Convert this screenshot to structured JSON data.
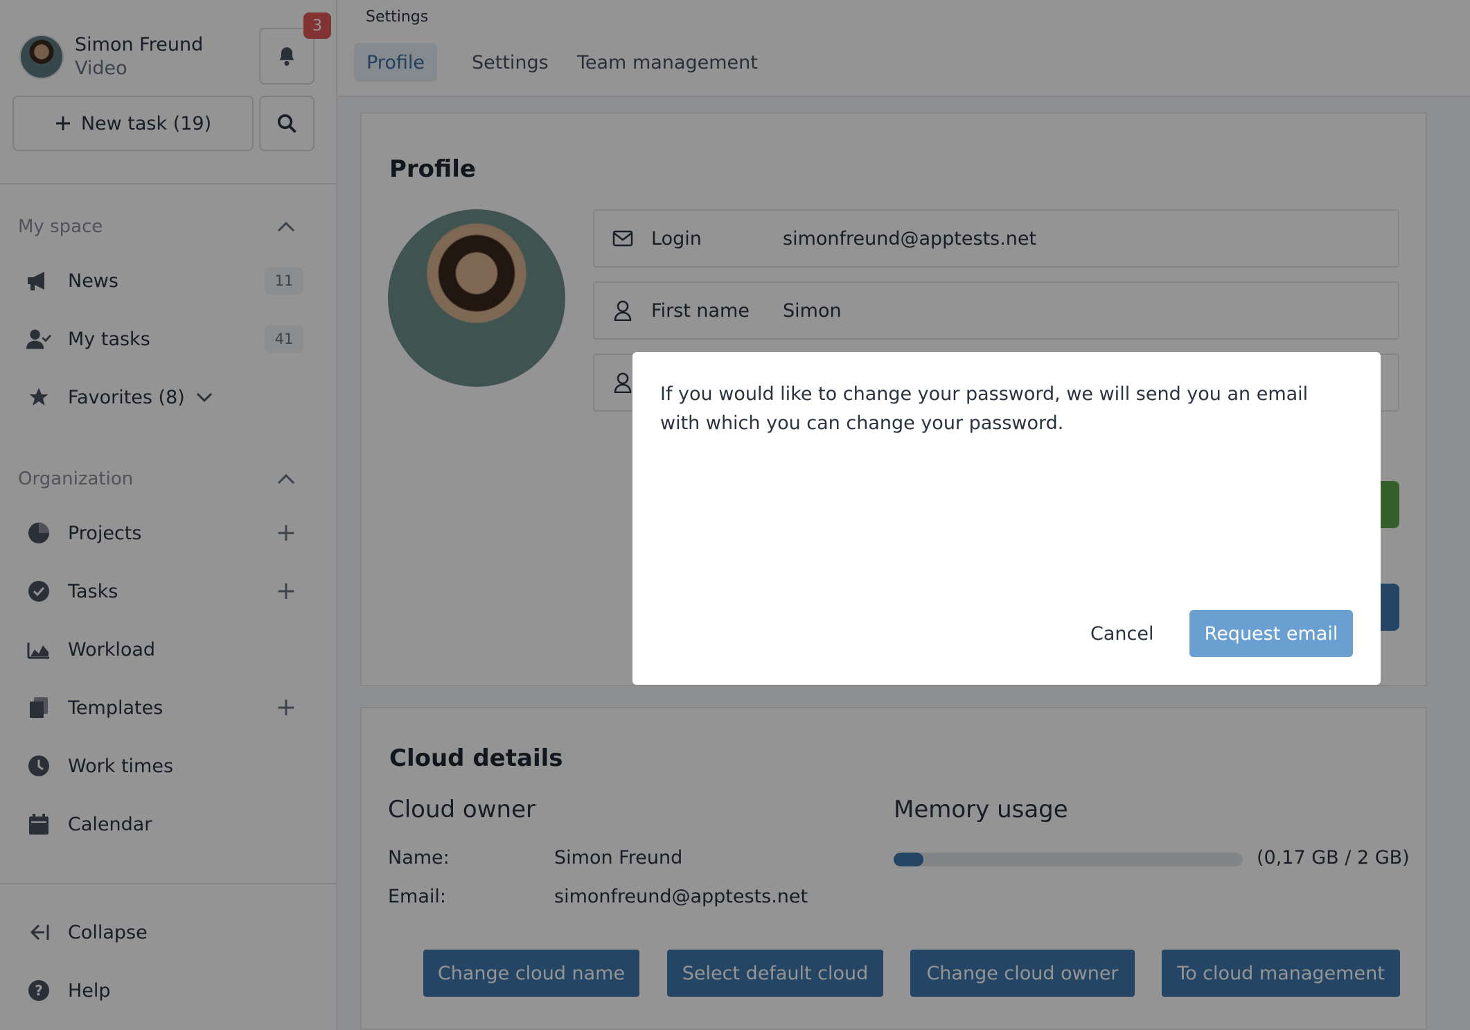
{
  "user": {
    "name": "Simon Freund",
    "subtitle": "Video",
    "notifications": "3"
  },
  "actions": {
    "new_task": "New task (19)"
  },
  "sidebar": {
    "my_space": {
      "title": "My space",
      "items": [
        {
          "label": "News",
          "count": "11",
          "icon": "megaphone-icon"
        },
        {
          "label": "My tasks",
          "count": "41",
          "icon": "user-check-icon"
        },
        {
          "label": "Favorites (8)",
          "icon": "star-icon"
        }
      ]
    },
    "organization": {
      "title": "Organization",
      "items": [
        {
          "label": "Projects",
          "icon": "pie-icon"
        },
        {
          "label": "Tasks",
          "icon": "check-circle-icon"
        },
        {
          "label": "Workload",
          "icon": "area-chart-icon"
        },
        {
          "label": "Templates",
          "icon": "copy-icon"
        },
        {
          "label": "Work times",
          "icon": "clock-icon"
        },
        {
          "label": "Calendar",
          "icon": "calendar-icon"
        }
      ]
    },
    "footer": {
      "collapse": "Collapse",
      "help": "Help"
    }
  },
  "header": {
    "breadcrumb": "Settings",
    "tabs": [
      {
        "label": "Profile",
        "active": true
      },
      {
        "label": "Settings",
        "active": false
      },
      {
        "label": "Team management",
        "active": false
      }
    ]
  },
  "profile": {
    "title": "Profile",
    "fields": [
      {
        "label": "Login",
        "value": "simonfreund@apptests.net",
        "icon": "mail-icon"
      },
      {
        "label": "First name",
        "value": "Simon",
        "icon": "user-icon"
      }
    ]
  },
  "cloud": {
    "title": "Cloud details",
    "owner_heading": "Cloud owner",
    "name_label": "Name:",
    "name_value": "Simon Freund",
    "email_label": "Email:",
    "email_value": "simonfreund@apptests.net",
    "memory_heading": "Memory usage",
    "memory_text": "(0,17 GB / 2 GB)",
    "memory_fraction": 0.085,
    "buttons": [
      "Change cloud name",
      "Select default cloud",
      "Change cloud owner",
      "To cloud management"
    ]
  },
  "modal": {
    "message": "If you would like to change your password, we will send you an email with which you can change your password.",
    "cancel": "Cancel",
    "confirm": "Request email"
  },
  "colors": {
    "accent": "#3f79ad",
    "badge": "#e05a5a",
    "success": "#5aa446"
  }
}
